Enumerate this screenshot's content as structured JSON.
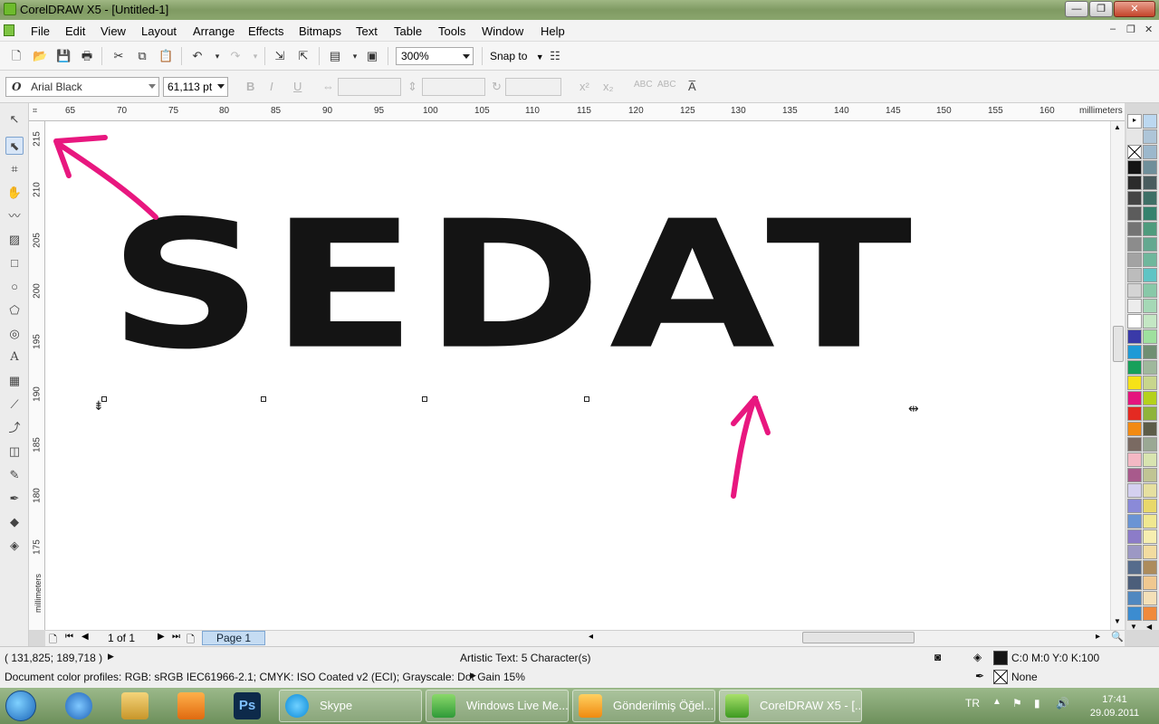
{
  "window": {
    "title": "CorelDRAW X5 - [Untitled-1]"
  },
  "menu": [
    "File",
    "Edit",
    "View",
    "Layout",
    "Arrange",
    "Effects",
    "Bitmaps",
    "Text",
    "Table",
    "Tools",
    "Window",
    "Help"
  ],
  "toolbar": {
    "zoom": "300%",
    "snap_label": "Snap to"
  },
  "property_bar": {
    "font_name": "Arial Black",
    "font_size": "61,113 pt"
  },
  "ruler": {
    "unit": "millimeters",
    "top_ticks": [
      "65",
      "70",
      "75",
      "80",
      "85",
      "90",
      "95",
      "100",
      "105",
      "110",
      "115",
      "120",
      "125",
      "130",
      "135",
      "140",
      "145",
      "150",
      "155",
      "160"
    ],
    "left_ticks": [
      "215",
      "210",
      "205",
      "200",
      "195",
      "190",
      "185",
      "180",
      "175"
    ]
  },
  "canvas": {
    "text": "SEDAT"
  },
  "navigator": {
    "page_count": "1 of 1",
    "page_tab": "Page 1"
  },
  "status": {
    "cursor_position": "( 131,825; 189,718 )",
    "selection_info": "Artistic Text: 5 Character(s)",
    "color_profiles": "Document color profiles: RGB: sRGB IEC61966-2.1; CMYK: ISO Coated v2 (ECI); Grayscale: Dot Gain 15%",
    "fill_value": "C:0 M:0 Y:0 K:100",
    "outline_value": "None"
  },
  "taskbar": {
    "tasks": [
      "Skype",
      "Windows Live Me...",
      "Gönderilmiş Öğel...",
      "CorelDRAW X5 - [..."
    ],
    "language": "TR",
    "time": "17:41",
    "date": "29.09.2011"
  },
  "colors": {
    "annotation_arrow": "#e8177f",
    "text_fill": "#141414",
    "page_tab": "#c5dcf3"
  }
}
